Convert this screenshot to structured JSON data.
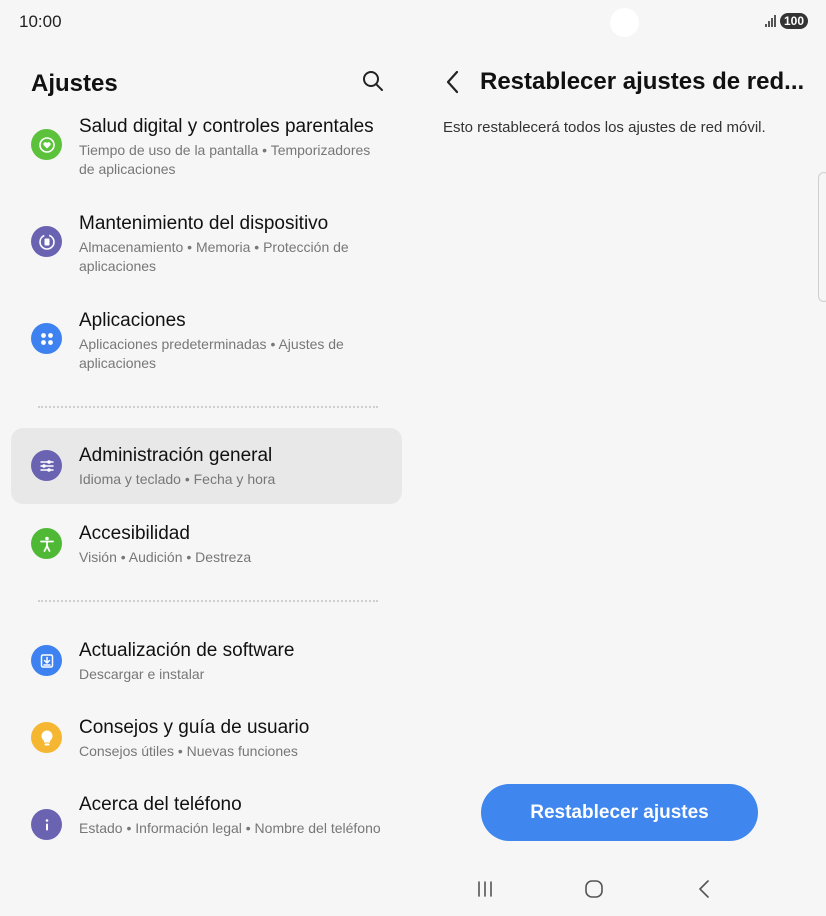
{
  "status_bar": {
    "time": "10:00",
    "battery": "100",
    "signal_icon": "signal-icon"
  },
  "left_pane": {
    "title": "Ajustes",
    "search_icon": "search-icon",
    "items": [
      {
        "title": "Salud digital y controles parentales",
        "subtitle": "Tiempo de uso de la pantalla • Temporizadores de aplicaciones",
        "icon": "heart-circle-icon",
        "icon_color": "#5cc23c"
      },
      {
        "title": "Mantenimiento del dispositivo",
        "subtitle": "Almacenamiento • Memoria • Protección de aplicaciones",
        "icon": "device-care-icon",
        "icon_color": "#6a63b2"
      },
      {
        "title": "Aplicaciones",
        "subtitle": "Aplicaciones predeterminadas • Ajustes de aplicaciones",
        "icon": "apps-grid-icon",
        "icon_color": "#3d82f0"
      },
      {
        "title": "Administración general",
        "subtitle": "Idioma y teclado • Fecha y hora",
        "icon": "sliders-icon",
        "icon_color": "#6a63b2",
        "selected": true
      },
      {
        "title": "Accesibilidad",
        "subtitle": "Visión • Audición • Destreza",
        "icon": "accessibility-icon",
        "icon_color": "#4fb935"
      },
      {
        "title": "Actualización de software",
        "subtitle": "Descargar e instalar",
        "icon": "download-icon",
        "icon_color": "#3d82f0"
      },
      {
        "title": "Consejos y guía de usuario",
        "subtitle": "Consejos útiles • Nuevas funciones",
        "icon": "lightbulb-icon",
        "icon_color": "#f5b731"
      },
      {
        "title": "Acerca del teléfono",
        "subtitle": "Estado • Información legal • Nombre del teléfono",
        "icon": "info-icon",
        "icon_color": "#6a63b2"
      }
    ]
  },
  "right_pane": {
    "back_icon": "back-arrow-icon",
    "title": "Restablecer ajustes de red...",
    "description": "Esto restablecerá todos los ajustes de red móvil.",
    "reset_button": "Restablecer ajustes",
    "accent_color": "#3f86ee"
  },
  "nav_bar": {
    "recents_icon": "recents-icon",
    "home_icon": "home-icon",
    "back_icon": "nav-back-icon"
  }
}
